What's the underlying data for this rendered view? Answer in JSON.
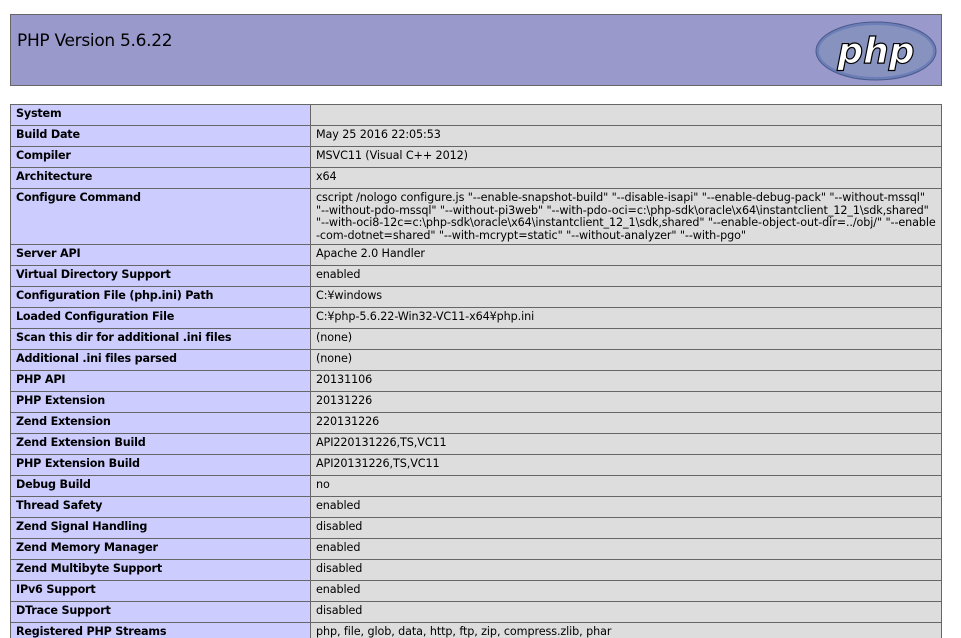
{
  "header": {
    "title": "PHP Version 5.6.22",
    "logo_text": "php",
    "logo_icon": "php-logo-icon"
  },
  "colors": {
    "header_bg": "#9999cc",
    "label_bg": "#ccccff",
    "value_bg": "#dddddd",
    "border": "#666666",
    "logo_fill": "#6c7eb7"
  },
  "rows": [
    {
      "label": "System",
      "value": ""
    },
    {
      "label": "Build Date",
      "value": "May 25 2016 22:05:53"
    },
    {
      "label": "Compiler",
      "value": "MSVC11 (Visual C++ 2012)"
    },
    {
      "label": "Architecture",
      "value": "x64"
    },
    {
      "label": "Configure Command",
      "value": "cscript /nologo configure.js \"--enable-snapshot-build\" \"--disable-isapi\" \"--enable-debug-pack\" \"--without-mssql\" \"--without-pdo-mssql\" \"--without-pi3web\" \"--with-pdo-oci=c:\\php-sdk\\oracle\\x64\\instantclient_12_1\\sdk,shared\" \"--with-oci8-12c=c:\\php-sdk\\oracle\\x64\\instantclient_12_1\\sdk,shared\" \"--enable-object-out-dir=../obj/\" \"--enable-com-dotnet=shared\" \"--with-mcrypt=static\" \"--without-analyzer\" \"--with-pgo\""
    },
    {
      "label": "Server API",
      "value": "Apache 2.0 Handler"
    },
    {
      "label": "Virtual Directory Support",
      "value": "enabled"
    },
    {
      "label": "Configuration File (php.ini) Path",
      "value": "C:¥windows"
    },
    {
      "label": "Loaded Configuration File",
      "value": "C:¥php-5.6.22-Win32-VC11-x64¥php.ini"
    },
    {
      "label": "Scan this dir for additional .ini files",
      "value": "(none)"
    },
    {
      "label": "Additional .ini files parsed",
      "value": "(none)"
    },
    {
      "label": "PHP API",
      "value": "20131106"
    },
    {
      "label": "PHP Extension",
      "value": "20131226"
    },
    {
      "label": "Zend Extension",
      "value": "220131226"
    },
    {
      "label": "Zend Extension Build",
      "value": "API220131226,TS,VC11"
    },
    {
      "label": "PHP Extension Build",
      "value": "API20131226,TS,VC11"
    },
    {
      "label": "Debug Build",
      "value": "no"
    },
    {
      "label": "Thread Safety",
      "value": "enabled"
    },
    {
      "label": "Zend Signal Handling",
      "value": "disabled"
    },
    {
      "label": "Zend Memory Manager",
      "value": "enabled"
    },
    {
      "label": "Zend Multibyte Support",
      "value": "disabled"
    },
    {
      "label": "IPv6 Support",
      "value": "enabled"
    },
    {
      "label": "DTrace Support",
      "value": "disabled"
    },
    {
      "label": "Registered PHP Streams",
      "value": "php, file, glob, data, http, ftp, zip, compress.zlib, phar"
    }
  ]
}
